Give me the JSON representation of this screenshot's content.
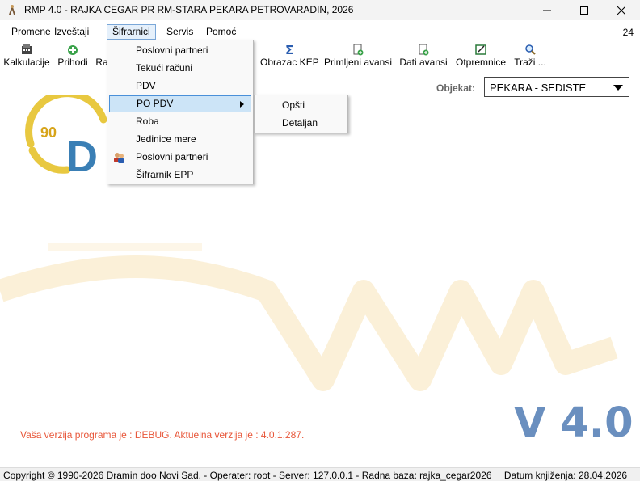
{
  "window": {
    "title": "RMP 4.0 - RAJKA CEGAR PR RM-STARA PEKARA PETROVARADIN, 2026",
    "minimize": "—",
    "maximize": "☐",
    "close": "✕"
  },
  "menubar": {
    "items": [
      "Promene",
      "Izveštaji",
      "Šifrarnici",
      "Servis",
      "Pomoć"
    ],
    "right_number": "24"
  },
  "toolbar": {
    "kalkulacije": "Kalkulacije",
    "prihodi": "Prihodi",
    "ra": "Ra",
    "obrazac_kep": "Obrazac KEP",
    "primljeni_avansi": "Primljeni avansi",
    "dati_avansi": "Dati avansi",
    "otpremnice": "Otpremnice",
    "trazi": "Traži ..."
  },
  "objekat": {
    "label": "Objekat:",
    "value": "PEKARA - SEDISTE"
  },
  "dropdown": {
    "items": [
      "Poslovni partneri",
      "Tekući računi",
      "PDV",
      "PO PDV",
      "Roba",
      "Jedinice mere",
      "Poslovni partneri",
      "Šifrarnik EPP"
    ]
  },
  "submenu": {
    "items": [
      "Opšti",
      "Detaljan"
    ]
  },
  "logo": {
    "years": "90"
  },
  "footer": {
    "version_info": "Vaša verzija programa je : DEBUG. Aktuelna verzija je : 4.0.1.287.",
    "version_big": "V 4.0"
  },
  "statusbar": {
    "left": "Copyright © 1990-2026 Dramin doo Novi Sad. - Operater: root - Server: 127.0.0.1 - Radna baza: rajka_cegar2026",
    "right": "Datum knjiženja: 28.04.2026"
  },
  "colors": {
    "accent": "#4a90d9",
    "highlight": "#cce4f7",
    "version_text": "#e8573a",
    "version_big": "#6a8fbf",
    "logo_yellow": "#e8c840",
    "logo_blue": "#3a7fb5"
  }
}
